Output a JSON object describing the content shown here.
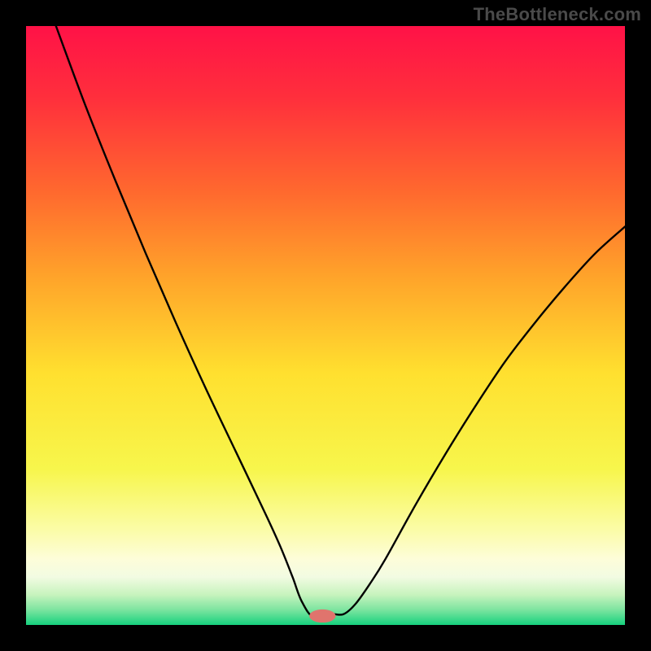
{
  "watermark": "TheBottleneck.com",
  "chart_data": {
    "type": "line",
    "title": "",
    "xlabel": "",
    "ylabel": "",
    "xlim": [
      0,
      100
    ],
    "ylim": [
      0,
      100
    ],
    "curve": {
      "x": [
        5,
        10,
        15,
        20,
        25,
        30,
        35,
        40,
        42.5,
        44.5,
        46,
        48,
        51,
        53,
        55,
        57.5,
        60,
        65,
        70,
        75,
        80,
        85,
        90,
        95,
        100
      ],
      "y": [
        100,
        86.5,
        74,
        62,
        50.5,
        39.5,
        29,
        18.5,
        13,
        8,
        4,
        1.3,
        1.8,
        1.8,
        3.5,
        7,
        11,
        20,
        28.5,
        36.5,
        44,
        50.5,
        56.5,
        62,
        66.5
      ]
    },
    "marker": {
      "x": 49.5,
      "y": 1.5,
      "rx": 2.2,
      "ry": 1.1,
      "fill": "#e0746d"
    },
    "gradient_stops": [
      {
        "offset": 0.0,
        "color": "#ff1247"
      },
      {
        "offset": 0.12,
        "color": "#ff2f3c"
      },
      {
        "offset": 0.28,
        "color": "#ff6a2e"
      },
      {
        "offset": 0.42,
        "color": "#ffa42a"
      },
      {
        "offset": 0.58,
        "color": "#ffe02f"
      },
      {
        "offset": 0.74,
        "color": "#f7f64c"
      },
      {
        "offset": 0.84,
        "color": "#fbfca6"
      },
      {
        "offset": 0.89,
        "color": "#fdfdd9"
      },
      {
        "offset": 0.92,
        "color": "#f2fbe2"
      },
      {
        "offset": 0.95,
        "color": "#c6f3bd"
      },
      {
        "offset": 0.975,
        "color": "#7be49f"
      },
      {
        "offset": 1.0,
        "color": "#16d17e"
      }
    ]
  }
}
